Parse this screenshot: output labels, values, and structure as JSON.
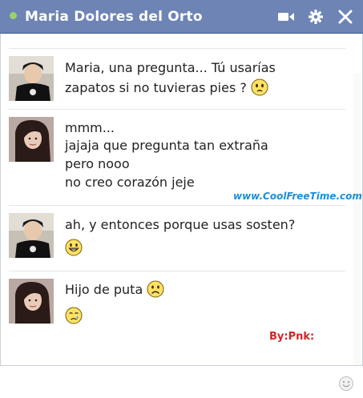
{
  "chat_window": {
    "title": "Maria Dolores del Orto",
    "status_color": "#9ad06d",
    "header_color": "#6d84b4",
    "icons": [
      "video-call-icon",
      "settings-gear-icon",
      "close-icon"
    ]
  },
  "messages": [
    {
      "sender": "avatar-dark-shirt",
      "lines": [
        "Maria, una pregunta... Tú usarías",
        "zapatos si no tuvieras pies ?"
      ],
      "emoticons": [
        "confused-smiley-icon"
      ]
    },
    {
      "sender": "avatar-long-hair",
      "lines": [
        "mmm...",
        "jajaja que pregunta tan extraña",
        "pero nooo",
        "no creo corazón jeje"
      ]
    },
    {
      "sender": "avatar-dark-shirt",
      "lines": [
        "ah, y entonces porque usas sosten?"
      ],
      "emoticons": [
        "grin-smiley-icon"
      ]
    },
    {
      "sender": "avatar-long-hair",
      "lines": [
        "Hijo de puta"
      ],
      "emoticons": [
        "frown-smiley-icon",
        "crying-smiley-icon"
      ]
    }
  ],
  "overlays": {
    "watermark": "www.CoolFreeTime.com",
    "signature": "By:Pnk:"
  },
  "composer": {
    "value": "",
    "placeholder": ""
  }
}
